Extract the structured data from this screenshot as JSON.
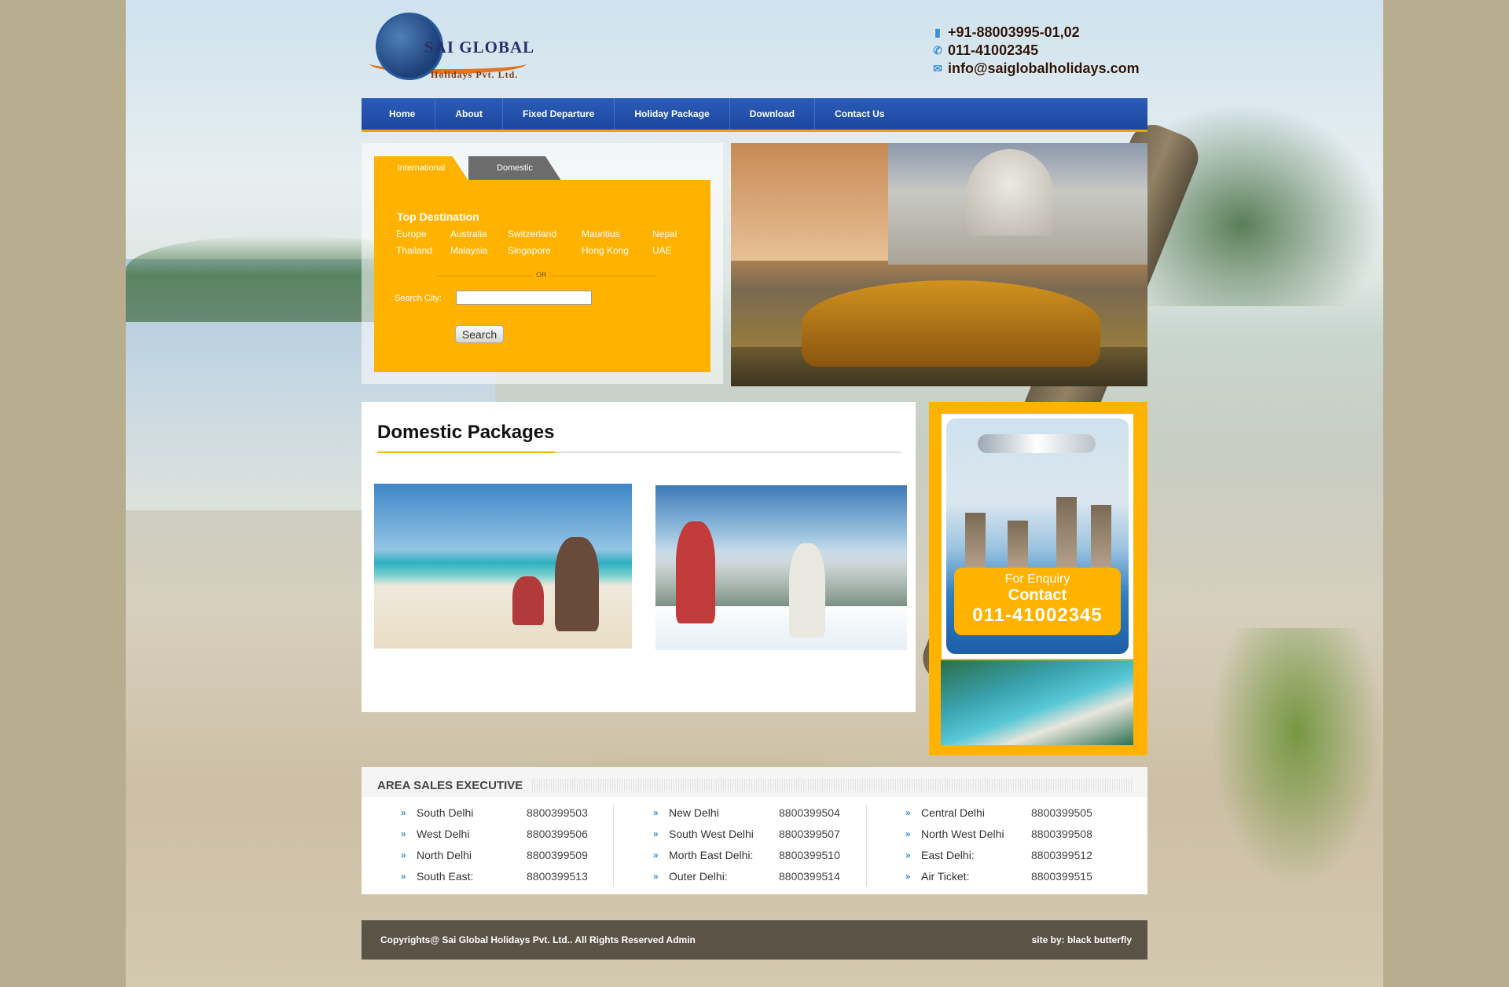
{
  "logo": {
    "name": "SAI GLOBAL",
    "subtitle": "Holidays Pvt. Ltd."
  },
  "contact": {
    "phone1": "+91-88003995-01,02",
    "phone2": "011-41002345",
    "email": "info@saiglobalholidays.com"
  },
  "nav": [
    "Home",
    "About",
    "Fixed Departure",
    "Holiday Package",
    "Download",
    "Contact Us"
  ],
  "search": {
    "tabs": {
      "international": "International",
      "domestic": "Domestic"
    },
    "top_destination_label": "Top Destination",
    "destinations": [
      [
        "Europe",
        "Australia",
        "Switzerland",
        "Mauritius",
        "Nepal"
      ],
      [
        "Thailand",
        "Malaysia",
        "Singapore",
        "Hong Kong",
        "UAE"
      ]
    ],
    "or": "OR",
    "city_label": "Search City:",
    "city_value": "",
    "button": "Search"
  },
  "packages": {
    "title": "Domestic Packages"
  },
  "enquiry": {
    "line1": "For Enquiry",
    "line2": "Contact",
    "phone": "011-41002345"
  },
  "sales": {
    "title": "AREA SALES EXECUTIVE",
    "columns": [
      [
        {
          "area": "South Delhi",
          "number": "8800399503"
        },
        {
          "area": "West Delhi",
          "number": "8800399506"
        },
        {
          "area": "North Delhi",
          "number": "8800399509"
        },
        {
          "area": "South East:",
          "number": "8800399513"
        }
      ],
      [
        {
          "area": "New Delhi",
          "number": "8800399504"
        },
        {
          "area": "South West Delhi",
          "number": "8800399507"
        },
        {
          "area": "Morth East Delhi:",
          "number": "8800399510"
        },
        {
          "area": "Outer Delhi:",
          "number": "8800399514"
        }
      ],
      [
        {
          "area": "Central Delhi",
          "number": "8800399505"
        },
        {
          "area": "North West Delhi",
          "number": "8800399508"
        },
        {
          "area": "East Delhi:",
          "number": "8800399512"
        },
        {
          "area": "Air Ticket:",
          "number": "8800399515"
        }
      ]
    ]
  },
  "footer": {
    "copyright": "Copyrights@ Sai Global Holidays Pvt. Ltd.. All Rights Reserved Admin",
    "credit": "site by: black butterfly"
  },
  "colors": {
    "nav": "#1c47a0",
    "accent": "#ffb300",
    "footer": "#463e34"
  },
  "icons": [
    "mobile-icon",
    "phone-icon",
    "mail-icon",
    "double-arrow-icon"
  ]
}
